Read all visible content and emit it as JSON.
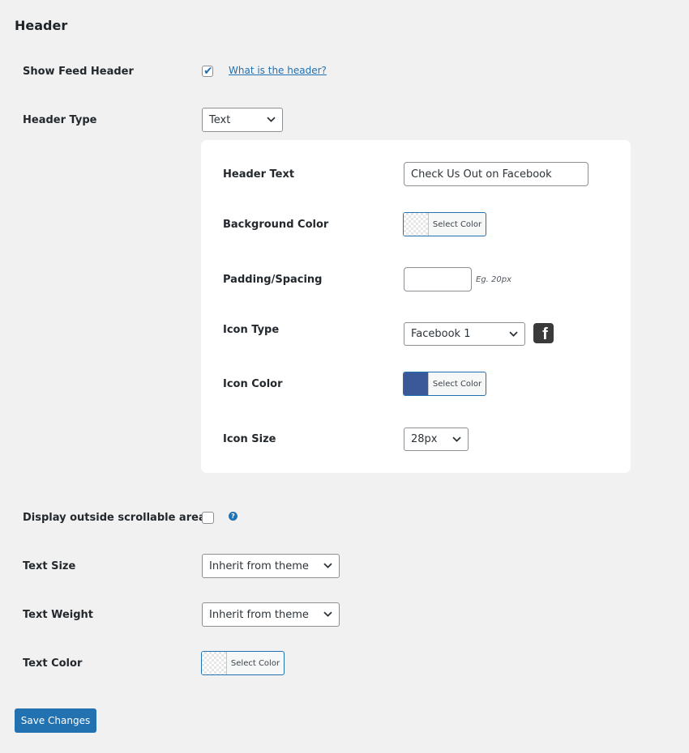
{
  "section_title": "Header",
  "show_feed_header": {
    "label": "Show Feed Header",
    "checked": true,
    "help_link": "What is the header?"
  },
  "header_type": {
    "label": "Header Type",
    "value": "Text"
  },
  "panel": {
    "header_text": {
      "label": "Header Text",
      "value": "Check Us Out on Facebook"
    },
    "background_color": {
      "label": "Background Color",
      "button": "Select Color"
    },
    "padding": {
      "label": "Padding/Spacing",
      "value": "",
      "hint": "Eg. 20px"
    },
    "icon_type": {
      "label": "Icon Type",
      "value": "Facebook 1",
      "icon": "facebook-square-icon"
    },
    "icon_color": {
      "label": "Icon Color",
      "button": "Select Color",
      "color": "#3b5998"
    },
    "icon_size": {
      "label": "Icon Size",
      "value": "28px"
    }
  },
  "display_outside": {
    "label": "Display outside scrollable area",
    "checked": false,
    "help_icon": "?"
  },
  "text_size": {
    "label": "Text Size",
    "value": "Inherit from theme"
  },
  "text_weight": {
    "label": "Text Weight",
    "value": "Inherit from theme"
  },
  "text_color": {
    "label": "Text Color",
    "button": "Select Color"
  },
  "save_button": "Save Changes",
  "colors": {
    "accent": "#2271b1",
    "background": "#f1f1f1",
    "panel": "#ffffff"
  }
}
